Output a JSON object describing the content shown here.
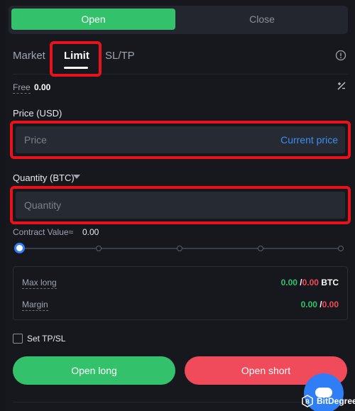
{
  "toggle": {
    "open_label": "Open",
    "close_label": "Close"
  },
  "tabs": {
    "market": "Market",
    "limit": "Limit",
    "sltp": "SL/TP"
  },
  "free": {
    "label": "Free",
    "value": "0.00"
  },
  "price": {
    "label": "Price (USD)",
    "placeholder": "Price",
    "action": "Current price"
  },
  "quantity": {
    "label": "Quantity (BTC)",
    "placeholder": "Quantity"
  },
  "contract_value": {
    "label": "Contract Value≈",
    "value": "0.00"
  },
  "slider": {
    "fraction": 0
  },
  "summary": {
    "max_long_label": "Max long",
    "max_long_long": "0.00",
    "max_long_sep": "/",
    "max_long_short": "0.00",
    "max_long_unit": "BTC",
    "margin_label": "Margin",
    "margin_long": "0.00",
    "margin_sep": "/",
    "margin_short": "0.00"
  },
  "tpsl": {
    "label": "Set TP/SL"
  },
  "actions": {
    "open_long": "Open long",
    "open_short": "Open short"
  },
  "watermark": {
    "text": "BitDegree"
  },
  "colors": {
    "accent_green": "#33c16c",
    "accent_red": "#ef4b5a",
    "accent_blue": "#2f7ef5",
    "highlight": "#e8121a"
  }
}
